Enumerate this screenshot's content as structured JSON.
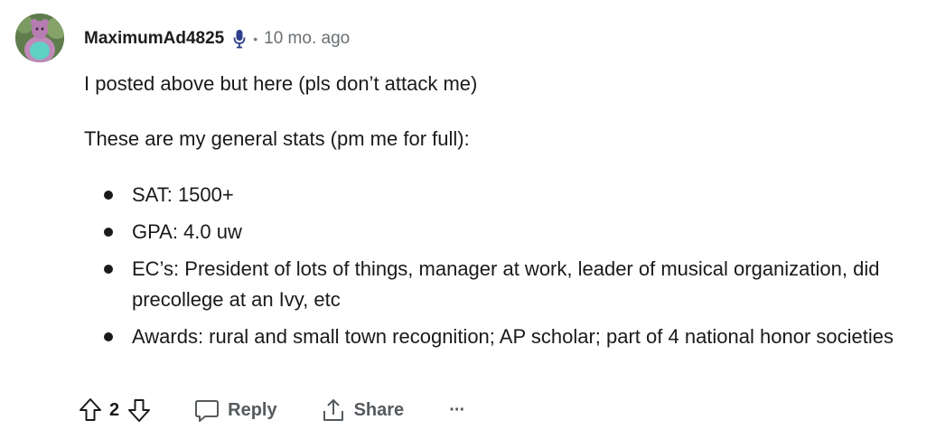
{
  "comment": {
    "author": "MaximumAd4825",
    "separator": "•",
    "time": "10 mo. ago",
    "paragraphs": [
      "I posted above but here (pls don’t attack me)",
      "These are my general stats (pm me for full):"
    ],
    "stats": [
      "SAT: 1500+",
      "GPA: 4.0 uw",
      "EC’s: President of lots of things, manager at work, leader of musical organization, did precollege at an Ivy, etc",
      "Awards: rural and small town recognition; AP scholar; part of 4 national honor societies"
    ]
  },
  "actions": {
    "vote_count": "2",
    "reply_label": "Reply",
    "share_label": "Share",
    "more_label": "···"
  },
  "colors": {
    "text": "#1a1a1b",
    "muted": "#6a6f73",
    "mic_icon": "#2f3e8c"
  },
  "icons": [
    "avatar-image",
    "microphone-icon",
    "upvote-icon",
    "downvote-icon",
    "reply-bubble-icon",
    "share-icon",
    "more-icon"
  ]
}
